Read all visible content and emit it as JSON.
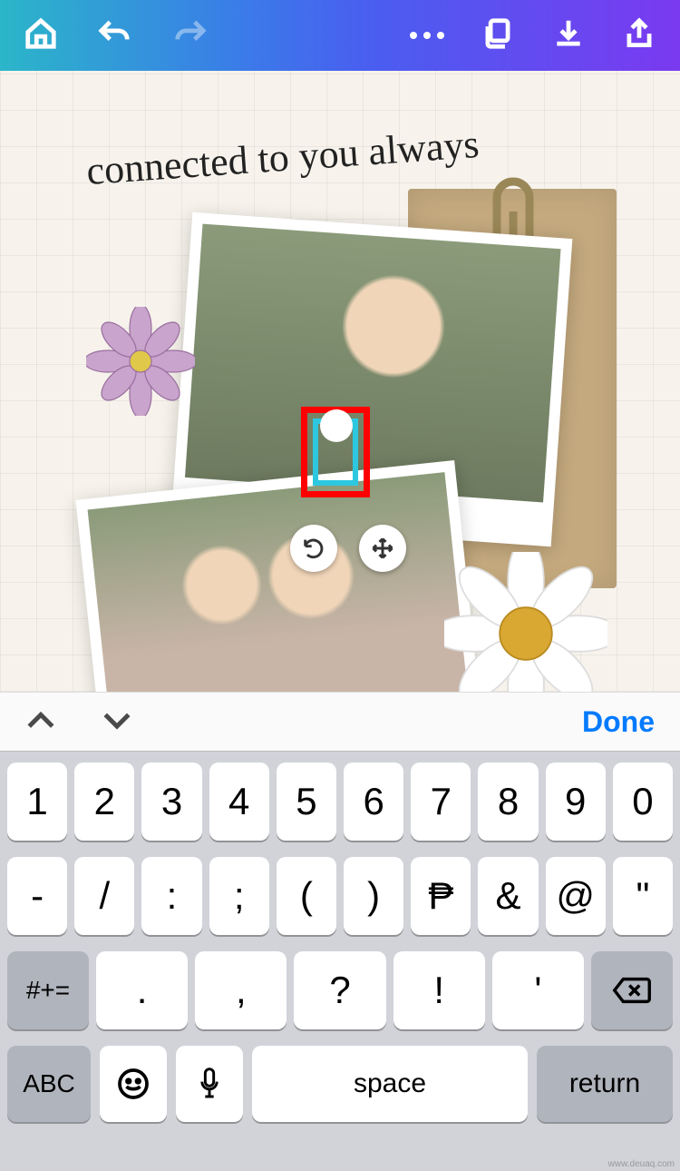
{
  "toolbar": {
    "icons": {
      "home": "home-icon",
      "undo": "undo-icon",
      "redo": "redo-icon",
      "more": "more-icon",
      "layers": "layers-icon",
      "download": "download-icon",
      "share": "share-icon"
    }
  },
  "canvas": {
    "headline_text": "connected to you always",
    "rotate_label": "rotate-icon",
    "move_label": "move-icon"
  },
  "accessory": {
    "prev": "chevron-up-icon",
    "next": "chevron-down-icon",
    "done_label": "Done"
  },
  "keyboard": {
    "row1": [
      "1",
      "2",
      "3",
      "4",
      "5",
      "6",
      "7",
      "8",
      "9",
      "0"
    ],
    "row2": [
      "-",
      "/",
      ":",
      ";",
      "(",
      ")",
      "₱",
      "&",
      "@",
      "\""
    ],
    "row3": {
      "switch": "#+=",
      "keys": [
        ".",
        ",",
        "?",
        "!",
        "'"
      ],
      "backspace": "backspace-icon"
    },
    "row4": {
      "abc": "ABC",
      "emoji": "emoji-icon",
      "mic": "mic-icon",
      "space": "space",
      "return": "return"
    }
  },
  "watermark": "www.deuaq.com"
}
